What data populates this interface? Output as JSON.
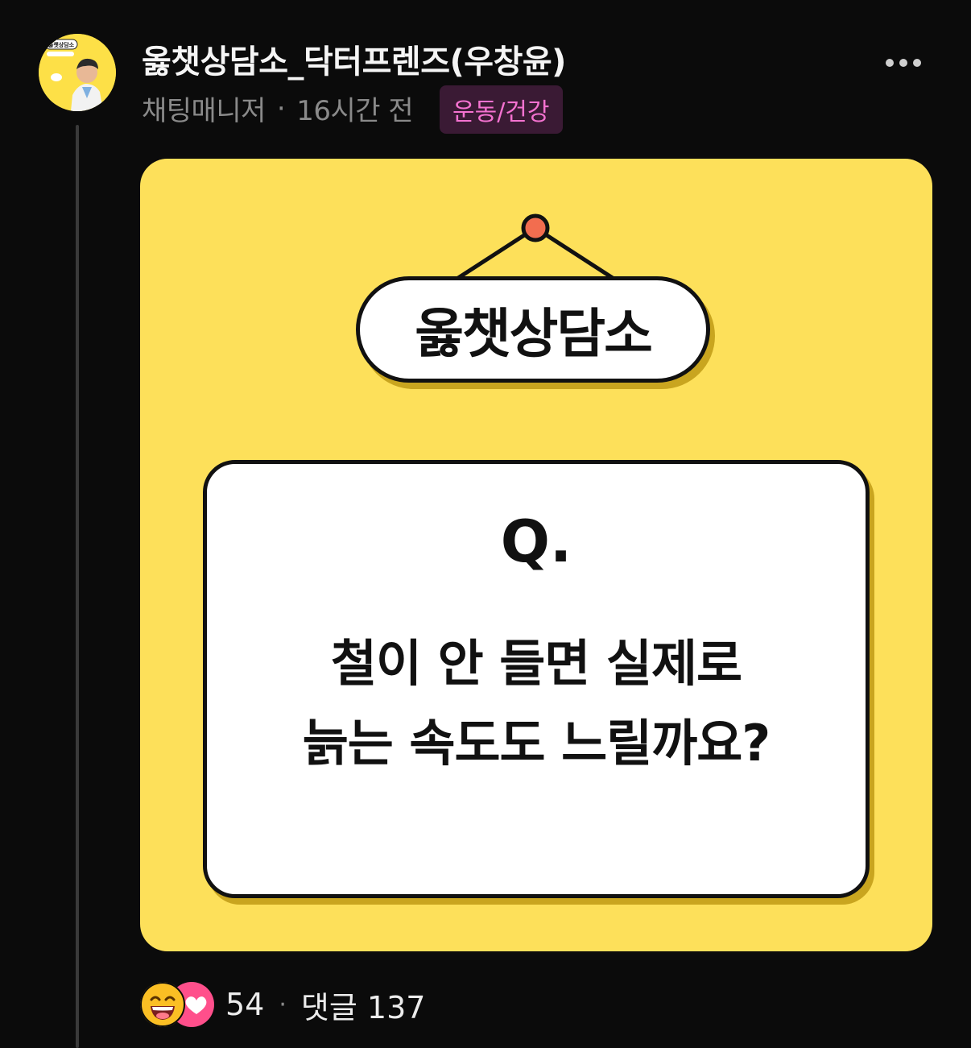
{
  "post": {
    "author": "옳챗상담소_닥터프렌즈(우창윤)",
    "role": "채팅매니저",
    "separator": "·",
    "time": "16시간 전",
    "category": "운동/건강",
    "avatar_badge": "옳챗상담소"
  },
  "image": {
    "sign_text": "옳챗상담소",
    "q_label": "Q.",
    "question_line1": "철이 안 들면 실제로",
    "question_line2": "늙는 속도도 느릴까요?",
    "colors": {
      "background": "#fde05a",
      "pin": "#f26d4f",
      "border": "#111111"
    }
  },
  "footer": {
    "reaction_count": "54",
    "separator": "·",
    "comments_label": "댓글 137"
  },
  "icons": [
    "more-icon",
    "laughing-face-icon",
    "heart-icon"
  ]
}
